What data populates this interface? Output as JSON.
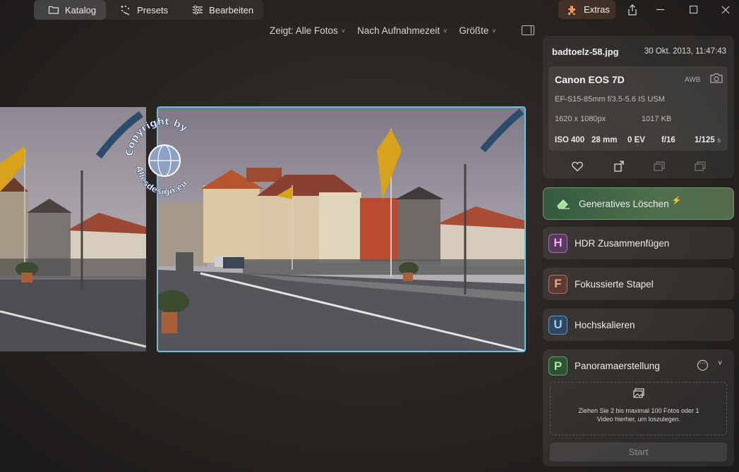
{
  "toolbar": {
    "tabs": [
      {
        "label": "Katalog",
        "icon": "folder-icon",
        "active": true
      },
      {
        "label": "Presets",
        "icon": "sparkle-wand-icon",
        "active": false
      },
      {
        "label": "Bearbeiten",
        "icon": "sliders-icon",
        "active": false
      }
    ],
    "extras_label": "Extras",
    "extras_icon": "puzzle-icon"
  },
  "filters": {
    "show": "Zeigt: Alle Fotos",
    "sort": "Nach Aufnahmezeit",
    "size": "Größte"
  },
  "watermark": {
    "line1": "Copyright by",
    "line2": "Allesdesign.eu"
  },
  "info": {
    "filename": "badtoelz-58.jpg",
    "datetime": "30 Okt. 2013, 11:47:43",
    "camera": "Canon EOS 7D",
    "white_balance": "AWB",
    "lens": "EF-S15-85mm f/3.5-5.6 IS USM",
    "resolution": "1620 x 1080px",
    "filesize": "1017 KB",
    "iso": "ISO 400",
    "focal": "28 mm",
    "ev": "0 EV",
    "aperture": "f/16",
    "shutter": "1/125",
    "shutter_unit": "s"
  },
  "tools": {
    "generative": "Generatives Löschen",
    "hdr": {
      "badge": "H",
      "label": "HDR Zusammenfügen"
    },
    "focus": {
      "badge": "F",
      "label": "Fokussierte Stapel"
    },
    "upscale": {
      "badge": "U",
      "label": "Hochskalieren"
    },
    "panorama": {
      "badge": "P",
      "label": "Panoramaerstellung",
      "drop_text": "Ziehen Sie 2 bis maximal 100 Fotos oder 1 Video hierher, um loszulegen.",
      "start_label": "Start"
    }
  },
  "colors": {
    "selection": "#5ec3ee",
    "generative_bg": "#4d6f4c"
  }
}
